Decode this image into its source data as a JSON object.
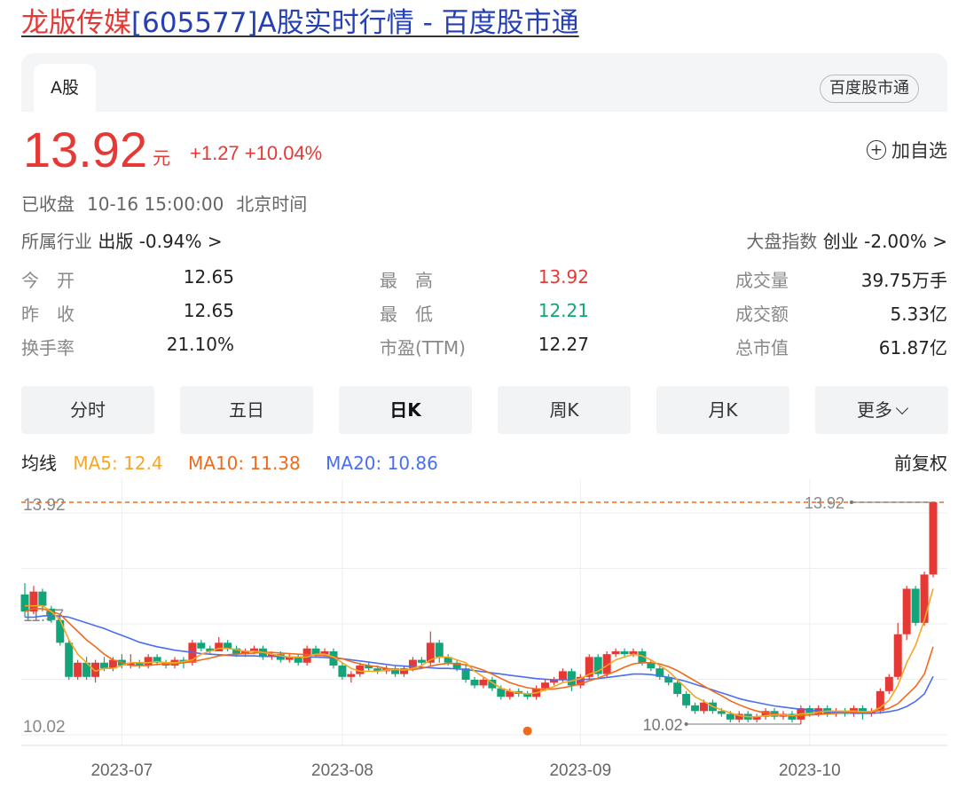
{
  "header": {
    "title_name": "龙版传媒",
    "title_rest": "[605577]A股实时行情 - 百度股市通"
  },
  "tabs": {
    "a_share": "A股",
    "brand": "百度股市通"
  },
  "quote": {
    "price": "13.92",
    "unit": "元",
    "change": "+1.27 +10.04%",
    "add_watch": "加自选",
    "status": "已收盘",
    "time": "10-16 15:00:00",
    "timezone": "北京时间"
  },
  "industry": {
    "label": "所属行业",
    "value": "出版 -0.94% >"
  },
  "index": {
    "label": "大盘指数",
    "value": "创业 -2.00% >"
  },
  "stats": [
    [
      {
        "label": "今　开",
        "value": "12.65"
      },
      {
        "label": "最　高",
        "value": "13.92",
        "color": "red"
      },
      {
        "label": "成交量",
        "value": "39.75万手"
      }
    ],
    [
      {
        "label": "昨　收",
        "value": "12.65"
      },
      {
        "label": "最　低",
        "value": "12.21",
        "color": "green"
      },
      {
        "label": "成交额",
        "value": "5.33亿"
      }
    ],
    [
      {
        "label": "换手率",
        "value": "21.10%"
      },
      {
        "label": "市盈(TTM)",
        "value": "12.27"
      },
      {
        "label": "总市值",
        "value": "61.87亿"
      }
    ]
  ],
  "periods": [
    "分时",
    "五日",
    "日K",
    "周K",
    "月K",
    "更多"
  ],
  "active_period": "日K",
  "ma": {
    "title": "均线",
    "ma5": "MA5: 12.4",
    "ma10": "MA10: 11.38",
    "ma20": "MA20: 10.86",
    "adjust": "前复权"
  },
  "colors": {
    "up": "#e53935",
    "down": "#12a57a",
    "ma5": "#f5a623",
    "ma10": "#f06a1c",
    "ma20": "#4a6ef0"
  },
  "chart_data": {
    "type": "candlestick",
    "y_ticks": [
      "13.92",
      "11.97",
      "10.02"
    ],
    "x_ticks": [
      "2023-07",
      "2023-08",
      "2023-09",
      "2023-10"
    ],
    "high_label": "13.92",
    "low_label": "10.02",
    "ylim": [
      10.02,
      13.92
    ],
    "candles": [
      [
        12.3,
        12.0,
        12.5,
        11.9
      ],
      [
        12.0,
        12.35,
        12.45,
        11.95
      ],
      [
        12.35,
        12.1,
        12.4,
        12.0
      ],
      [
        12.05,
        11.85,
        12.1,
        11.8
      ],
      [
        11.85,
        11.45,
        11.9,
        11.4
      ],
      [
        11.45,
        10.85,
        11.5,
        10.8
      ],
      [
        10.85,
        11.1,
        11.15,
        10.8
      ],
      [
        11.1,
        10.85,
        11.2,
        10.8
      ],
      [
        10.85,
        11.1,
        11.15,
        10.75
      ],
      [
        11.1,
        11.0,
        11.2,
        10.95
      ],
      [
        11.0,
        11.15,
        11.2,
        10.95
      ],
      [
        11.15,
        11.05,
        11.25,
        11.0
      ],
      [
        11.05,
        11.1,
        11.25,
        11.0
      ],
      [
        11.1,
        11.05,
        11.15,
        11.0
      ],
      [
        11.05,
        11.2,
        11.25,
        11.0
      ],
      [
        11.2,
        11.1,
        11.25,
        11.05
      ],
      [
        11.1,
        11.05,
        11.15,
        11.0
      ],
      [
        11.05,
        11.15,
        11.2,
        11.0
      ],
      [
        11.15,
        11.1,
        11.2,
        11.0
      ],
      [
        11.1,
        11.45,
        11.5,
        11.05
      ],
      [
        11.45,
        11.35,
        11.5,
        11.3
      ],
      [
        11.35,
        11.3,
        11.4,
        11.25
      ],
      [
        11.3,
        11.45,
        11.55,
        11.3
      ],
      [
        11.45,
        11.35,
        11.5,
        11.3
      ],
      [
        11.35,
        11.25,
        11.4,
        11.2
      ],
      [
        11.25,
        11.3,
        11.35,
        11.2
      ],
      [
        11.3,
        11.35,
        11.4,
        11.25
      ],
      [
        11.35,
        11.2,
        11.4,
        11.15
      ],
      [
        11.2,
        11.25,
        11.3,
        11.15
      ],
      [
        11.25,
        11.15,
        11.3,
        11.1
      ],
      [
        11.15,
        11.2,
        11.25,
        11.1
      ],
      [
        11.2,
        11.1,
        11.25,
        11.05
      ],
      [
        11.1,
        11.35,
        11.4,
        11.05
      ],
      [
        11.35,
        11.25,
        11.4,
        11.2
      ],
      [
        11.25,
        11.3,
        11.35,
        11.2
      ],
      [
        11.3,
        11.05,
        11.35,
        11.0
      ],
      [
        11.05,
        10.85,
        11.1,
        10.8
      ],
      [
        10.85,
        10.9,
        10.95,
        10.75
      ],
      [
        10.9,
        11.05,
        11.1,
        10.85
      ],
      [
        11.05,
        11.0,
        11.1,
        10.95
      ],
      [
        11.0,
        10.95,
        11.05,
        10.9
      ],
      [
        10.95,
        11.0,
        11.05,
        10.9
      ],
      [
        11.0,
        10.9,
        11.05,
        10.85
      ],
      [
        10.9,
        11.0,
        11.05,
        10.85
      ],
      [
        11.0,
        11.15,
        11.2,
        10.95
      ],
      [
        11.15,
        11.1,
        11.2,
        11.05
      ],
      [
        11.1,
        11.45,
        11.65,
        11.05
      ],
      [
        11.45,
        11.2,
        11.5,
        11.1
      ],
      [
        11.2,
        11.1,
        11.25,
        11.05
      ],
      [
        11.1,
        11.0,
        11.15,
        10.95
      ],
      [
        11.0,
        10.8,
        11.05,
        10.75
      ],
      [
        10.8,
        10.7,
        10.85,
        10.65
      ],
      [
        10.7,
        10.8,
        10.85,
        10.65
      ],
      [
        10.8,
        10.65,
        10.85,
        10.6
      ],
      [
        10.65,
        10.5,
        10.7,
        10.45
      ],
      [
        10.5,
        10.6,
        10.65,
        10.45
      ],
      [
        10.6,
        10.55,
        10.65,
        10.5
      ],
      [
        10.55,
        10.5,
        10.6,
        10.45
      ],
      [
        10.5,
        10.65,
        10.7,
        10.45
      ],
      [
        10.65,
        10.75,
        10.8,
        10.6
      ],
      [
        10.75,
        10.8,
        10.85,
        10.7
      ],
      [
        10.8,
        10.95,
        11.0,
        10.75
      ],
      [
        10.95,
        10.7,
        11.0,
        10.6
      ],
      [
        10.7,
        10.85,
        10.9,
        10.65
      ],
      [
        10.85,
        11.2,
        11.25,
        10.8
      ],
      [
        11.2,
        10.9,
        11.25,
        10.85
      ],
      [
        10.9,
        11.25,
        11.3,
        10.85
      ],
      [
        11.25,
        11.3,
        11.35,
        11.2
      ],
      [
        11.3,
        11.25,
        11.35,
        11.2
      ],
      [
        11.25,
        11.3,
        11.35,
        11.2
      ],
      [
        11.3,
        11.1,
        11.35,
        11.05
      ],
      [
        11.1,
        11.0,
        11.15,
        10.95
      ],
      [
        11.0,
        10.85,
        11.05,
        10.8
      ],
      [
        10.85,
        10.75,
        10.9,
        10.7
      ],
      [
        10.75,
        10.55,
        10.8,
        10.5
      ],
      [
        10.55,
        10.35,
        10.6,
        10.3
      ],
      [
        10.35,
        10.25,
        10.4,
        10.2
      ],
      [
        10.25,
        10.4,
        10.45,
        10.2
      ],
      [
        10.4,
        10.25,
        10.45,
        10.2
      ],
      [
        10.25,
        10.2,
        10.3,
        10.15
      ],
      [
        10.2,
        10.1,
        10.25,
        10.05
      ],
      [
        10.1,
        10.2,
        10.25,
        10.05
      ],
      [
        10.2,
        10.1,
        10.25,
        10.05
      ],
      [
        10.1,
        10.15,
        10.2,
        10.05
      ],
      [
        10.15,
        10.25,
        10.3,
        10.1
      ],
      [
        10.25,
        10.15,
        10.3,
        10.1
      ],
      [
        10.15,
        10.2,
        10.25,
        10.1
      ],
      [
        10.2,
        10.1,
        10.25,
        10.05
      ],
      [
        10.1,
        10.3,
        10.35,
        10.02
      ],
      [
        10.3,
        10.2,
        10.35,
        10.15
      ],
      [
        10.2,
        10.3,
        10.35,
        10.15
      ],
      [
        10.3,
        10.2,
        10.35,
        10.15
      ],
      [
        10.2,
        10.25,
        10.3,
        10.15
      ],
      [
        10.25,
        10.2,
        10.3,
        10.15
      ],
      [
        10.2,
        10.3,
        10.35,
        10.15
      ],
      [
        10.3,
        10.2,
        10.35,
        10.1
      ],
      [
        10.2,
        10.25,
        10.3,
        10.15
      ],
      [
        10.25,
        10.6,
        10.65,
        10.2
      ],
      [
        10.6,
        10.85,
        10.9,
        10.55
      ],
      [
        10.85,
        11.6,
        11.8,
        10.8
      ],
      [
        11.6,
        12.4,
        12.45,
        11.5
      ],
      [
        12.4,
        11.8,
        12.45,
        11.75
      ],
      [
        11.8,
        12.65,
        12.7,
        11.75
      ],
      [
        12.65,
        13.92,
        13.92,
        12.6
      ]
    ],
    "ma5": [
      12.1,
      12.1,
      12.1,
      12.0,
      11.85,
      11.5,
      11.25,
      11.1,
      10.95,
      11.0,
      11.0,
      11.05,
      11.1,
      11.1,
      11.1,
      11.12,
      11.1,
      11.1,
      11.12,
      11.15,
      11.25,
      11.3,
      11.35,
      11.35,
      11.33,
      11.3,
      11.3,
      11.28,
      11.25,
      11.22,
      11.2,
      11.2,
      11.2,
      11.25,
      11.25,
      11.2,
      11.1,
      11.0,
      10.95,
      10.95,
      10.95,
      10.97,
      10.98,
      10.97,
      11.0,
      11.05,
      11.15,
      11.2,
      11.2,
      11.15,
      11.1,
      10.95,
      10.85,
      10.75,
      10.65,
      10.6,
      10.57,
      10.55,
      10.57,
      10.62,
      10.68,
      10.75,
      10.78,
      10.82,
      10.9,
      10.95,
      11.05,
      11.15,
      11.2,
      11.25,
      11.22,
      11.15,
      11.05,
      10.95,
      10.8,
      10.65,
      10.5,
      10.42,
      10.33,
      10.27,
      10.22,
      10.17,
      10.15,
      10.15,
      10.17,
      10.18,
      10.18,
      10.17,
      10.2,
      10.21,
      10.23,
      10.25,
      10.25,
      10.25,
      10.25,
      10.24,
      10.24,
      10.31,
      10.44,
      10.7,
      11.1,
      11.4,
      11.85,
      12.4
    ],
    "ma10": [
      12.0,
      12.05,
      12.05,
      12.0,
      11.95,
      11.8,
      11.65,
      11.5,
      11.38,
      11.25,
      11.15,
      11.1,
      11.05,
      11.05,
      11.05,
      11.07,
      11.08,
      11.08,
      11.1,
      11.12,
      11.15,
      11.18,
      11.22,
      11.24,
      11.25,
      11.26,
      11.27,
      11.28,
      11.28,
      11.27,
      11.26,
      11.25,
      11.24,
      11.23,
      11.22,
      11.2,
      11.17,
      11.12,
      11.08,
      11.05,
      11.03,
      11.0,
      10.98,
      10.97,
      10.98,
      11.0,
      11.04,
      11.07,
      11.09,
      11.08,
      11.06,
      11.02,
      10.97,
      10.9,
      10.82,
      10.75,
      10.7,
      10.66,
      10.64,
      10.63,
      10.64,
      10.66,
      10.69,
      10.73,
      10.78,
      10.83,
      10.89,
      10.95,
      11.02,
      11.08,
      11.1,
      11.1,
      11.08,
      11.03,
      10.96,
      10.87,
      10.78,
      10.69,
      10.6,
      10.52,
      10.43,
      10.36,
      10.3,
      10.25,
      10.22,
      10.2,
      10.18,
      10.17,
      10.17,
      10.18,
      10.19,
      10.2,
      10.21,
      10.22,
      10.23,
      10.23,
      10.24,
      10.26,
      10.3,
      10.38,
      10.53,
      10.68,
      10.9,
      11.38
    ],
    "ma20": [
      11.9,
      11.9,
      11.92,
      11.93,
      11.92,
      11.9,
      11.85,
      11.8,
      11.75,
      11.7,
      11.64,
      11.58,
      11.52,
      11.46,
      11.42,
      11.38,
      11.35,
      11.32,
      11.3,
      11.28,
      11.26,
      11.25,
      11.24,
      11.23,
      11.22,
      11.22,
      11.22,
      11.21,
      11.21,
      11.21,
      11.2,
      11.2,
      11.2,
      11.2,
      11.19,
      11.18,
      11.17,
      11.15,
      11.13,
      11.11,
      11.09,
      11.07,
      11.05,
      11.04,
      11.03,
      11.02,
      11.01,
      11.0,
      11.0,
      10.99,
      10.98,
      10.96,
      10.94,
      10.92,
      10.9,
      10.88,
      10.86,
      10.84,
      10.82,
      10.81,
      10.8,
      10.8,
      10.8,
      10.8,
      10.81,
      10.82,
      10.84,
      10.86,
      10.88,
      10.9,
      10.9,
      10.89,
      10.87,
      10.84,
      10.81,
      10.77,
      10.72,
      10.67,
      10.62,
      10.57,
      10.52,
      10.47,
      10.43,
      10.4,
      10.37,
      10.34,
      10.32,
      10.3,
      10.28,
      10.27,
      10.25,
      10.24,
      10.23,
      10.22,
      10.21,
      10.21,
      10.21,
      10.22,
      10.24,
      10.27,
      10.33,
      10.42,
      10.55,
      10.86
    ],
    "x_tick_index": [
      11,
      36,
      63,
      89
    ],
    "marker_dot": {
      "index": 57,
      "value": 9.9
    }
  }
}
